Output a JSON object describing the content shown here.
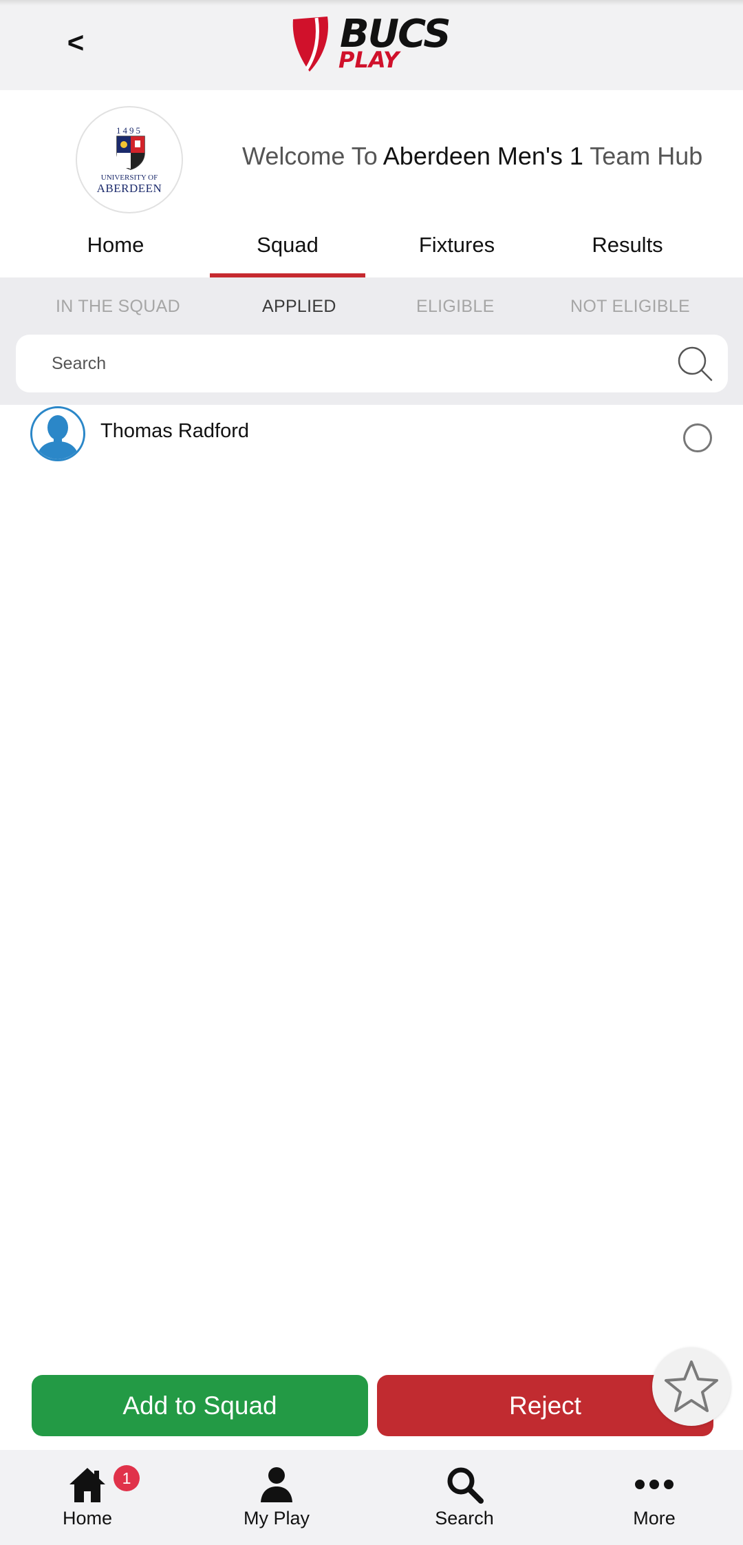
{
  "header": {
    "back_label": "<",
    "brand": {
      "primary": "BUCS",
      "secondary": "PLAY"
    }
  },
  "team": {
    "crest": {
      "year": "1495",
      "line1": "UNIVERSITY OF",
      "line2": "ABERDEEN"
    },
    "welcome_prefix": "Welcome To ",
    "team_name": "Aberdeen Men's 1",
    "welcome_suffix": " Team Hub"
  },
  "tabs": [
    {
      "label": "Home",
      "active": false
    },
    {
      "label": "Squad",
      "active": true
    },
    {
      "label": "Fixtures",
      "active": false
    },
    {
      "label": "Results",
      "active": false
    }
  ],
  "subtabs": [
    {
      "label": "IN THE SQUAD",
      "active": false
    },
    {
      "label": "APPLIED",
      "active": true
    },
    {
      "label": "ELIGIBLE",
      "active": false
    },
    {
      "label": "NOT ELIGIBLE",
      "active": false
    }
  ],
  "search": {
    "placeholder": "Search",
    "value": ""
  },
  "players": [
    {
      "name": "Thomas Radford",
      "selected": false
    }
  ],
  "actions": {
    "add_label": "Add to Squad",
    "reject_label": "Reject"
  },
  "bottom_nav": [
    {
      "label": "Home",
      "icon": "home-icon",
      "badge": "1"
    },
    {
      "label": "My Play",
      "icon": "person-icon"
    },
    {
      "label": "Search",
      "icon": "search-icon"
    },
    {
      "label": "More",
      "icon": "more-icon"
    }
  ],
  "colors": {
    "brand_red": "#d0112b",
    "tab_underline": "#c62a30",
    "add_button": "#239a45",
    "reject_button": "#c12b30",
    "avatar_blue": "#2b87c8",
    "badge": "#e0324a"
  }
}
